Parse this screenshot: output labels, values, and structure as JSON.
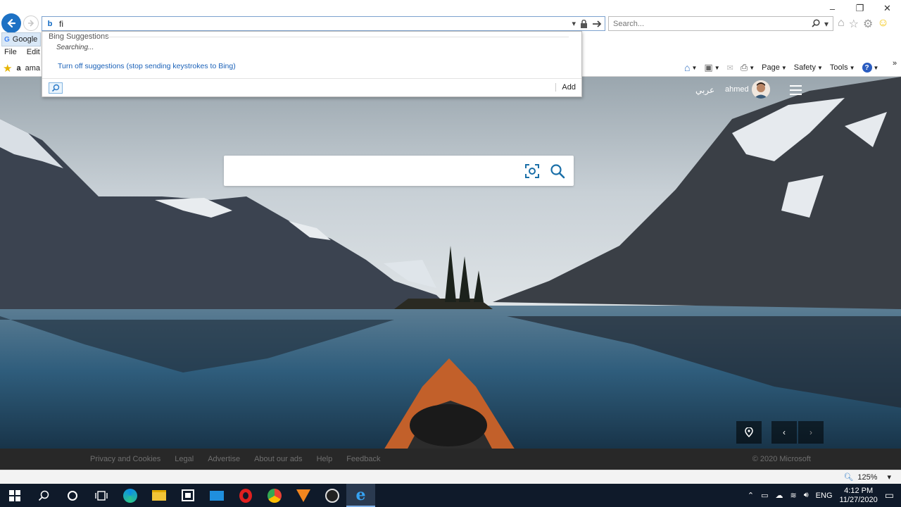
{
  "browser": {
    "address_value": "fi",
    "search_placeholder": "Search...",
    "window_controls": [
      "–",
      "❐",
      "✕"
    ],
    "tab": {
      "label": "Google"
    },
    "menu": [
      "File",
      "Edit"
    ],
    "favorites_label": "ama",
    "command_bar": {
      "page": "Page",
      "safety": "Safety",
      "tools": "Tools"
    }
  },
  "suggest": {
    "header": "Bing Suggestions",
    "status": "Searching...",
    "turn_off": "Turn off suggestions (stop sending keystrokes to Bing)",
    "add": "Add"
  },
  "bing": {
    "lang_link": "عربي",
    "user_name": "ahmed",
    "search_placeholder": "",
    "footer_links": [
      "Privacy and Cookies",
      "Legal",
      "Advertise",
      "About our ads",
      "Help",
      "Feedback"
    ],
    "copyright": "© 2020 Microsoft"
  },
  "status": {
    "zoom": "125%"
  },
  "taskbar": {
    "lang": "ENG",
    "time": "4:12 PM",
    "date": "11/27/2020"
  }
}
